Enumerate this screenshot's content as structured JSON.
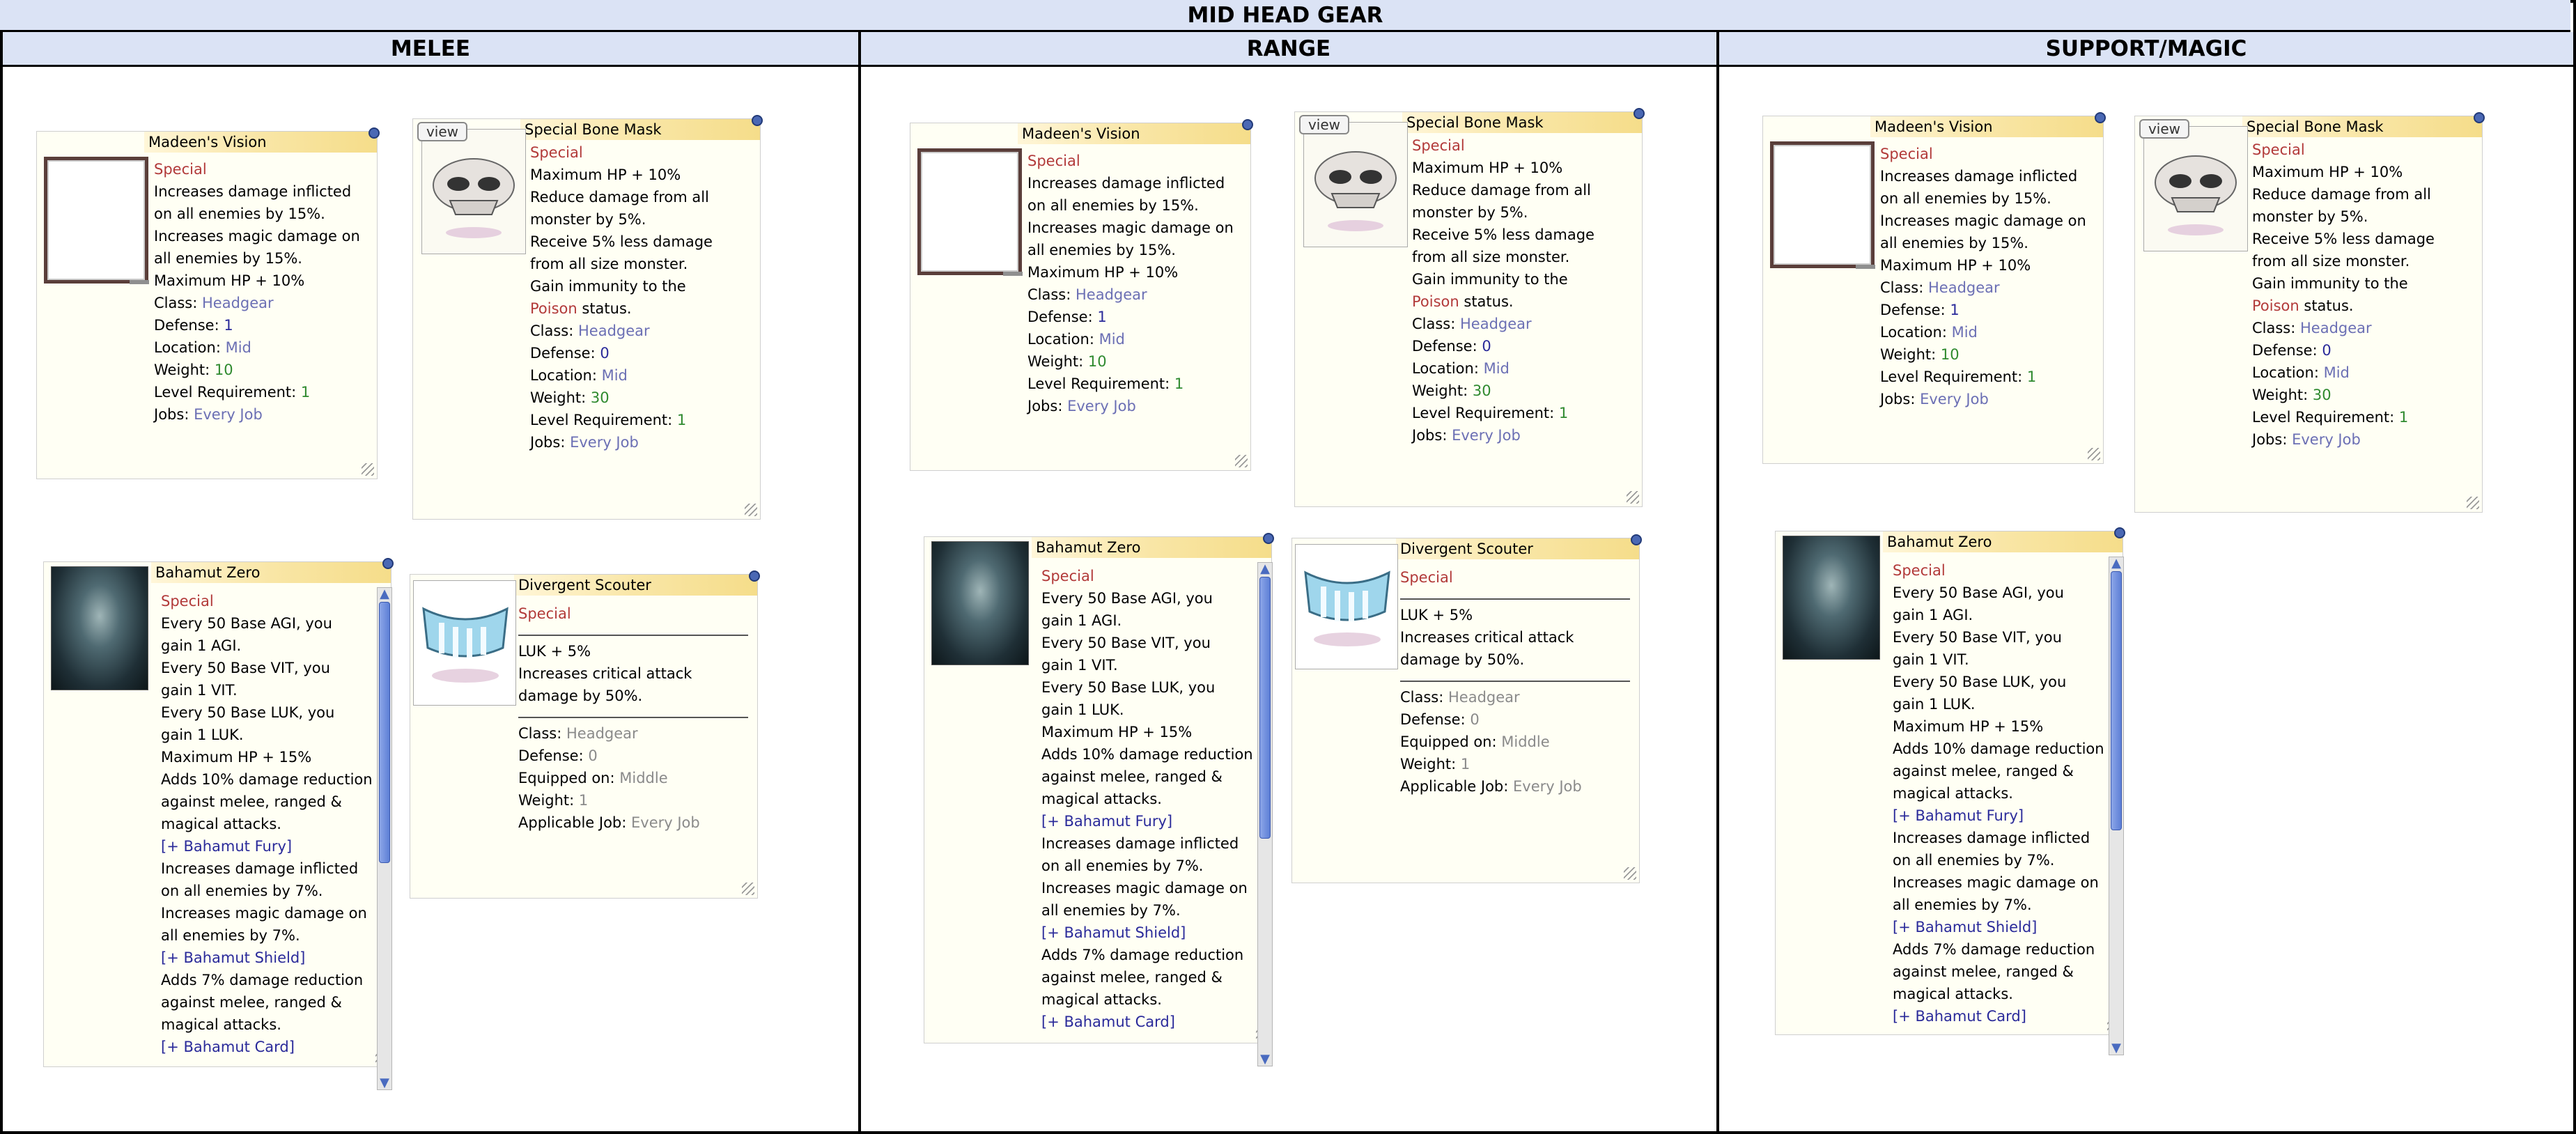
{
  "title": "MID HEAD GEAR",
  "columns": [
    "MELEE",
    "RANGE",
    "SUPPORT/MAGIC"
  ],
  "items": {
    "madeen": {
      "name": "Madeen's Vision",
      "lines": [
        {
          "t": "Special",
          "c": "red"
        },
        {
          "t": "Increases damage inflicted"
        },
        {
          "t": "on all enemies by 15%."
        },
        {
          "t": "Increases magic damage on"
        },
        {
          "t": "all enemies by 15%."
        },
        {
          "t": "Maximum HP + 10%"
        },
        {
          "k": "Class: ",
          "v": "Headgear",
          "c": "blue"
        },
        {
          "k": "Defense: ",
          "v": "1",
          "c": "dblue"
        },
        {
          "k": "Location: ",
          "v": "Mid",
          "c": "blue"
        },
        {
          "k": "Weight: ",
          "v": "10",
          "c": "green"
        },
        {
          "k": "Level Requirement: ",
          "v": "1",
          "c": "green"
        },
        {
          "k": "Jobs: ",
          "v": "Every Job",
          "c": "blue"
        }
      ]
    },
    "bonemask": {
      "name": "Special Bone Mask",
      "view": "view",
      "lines": [
        {
          "t": "Special",
          "c": "red"
        },
        {
          "t": "Maximum HP + 10%"
        },
        {
          "t": "Reduce damage from all"
        },
        {
          "t": "monster by 5%."
        },
        {
          "t": "Receive 5% less damage"
        },
        {
          "t": "from all size monster."
        },
        {
          "t": "Gain immunity to the"
        },
        {
          "k": "Poison",
          "v": " status.",
          "c": "redk"
        },
        {
          "k": "Class: ",
          "v": "Headgear",
          "c": "blue"
        },
        {
          "k": "Defense: ",
          "v": "0",
          "c": "dblue"
        },
        {
          "k": "Location: ",
          "v": "Mid",
          "c": "blue"
        },
        {
          "k": "Weight: ",
          "v": "30",
          "c": "green"
        },
        {
          "k": "Level Requirement: ",
          "v": "1",
          "c": "green"
        },
        {
          "k": "Jobs: ",
          "v": "Every Job",
          "c": "blue"
        }
      ]
    },
    "bahamut": {
      "name": "Bahamut Zero",
      "lines": [
        {
          "t": "Special",
          "c": "red"
        },
        {
          "t": "Every 50 Base AGI, you"
        },
        {
          "t": "gain 1 AGI."
        },
        {
          "t": "Every 50 Base VIT, you"
        },
        {
          "t": "gain 1 VIT."
        },
        {
          "t": "Every 50 Base LUK, you"
        },
        {
          "t": "gain 1 LUK."
        },
        {
          "t": "Maximum HP + 15%"
        },
        {
          "t": "Adds 10% damage reduction"
        },
        {
          "t": "against melee, ranged &"
        },
        {
          "t": "magical attacks."
        },
        {
          "t": "[+ Bahamut Fury]",
          "c": "dblue"
        },
        {
          "t": "Increases damage inflicted"
        },
        {
          "t": "on all enemies by 7%."
        },
        {
          "t": "Increases magic damage on"
        },
        {
          "t": "all enemies by 7%."
        },
        {
          "t": "[+ Bahamut Shield]",
          "c": "dblue"
        },
        {
          "t": "Adds 7% damage reduction"
        },
        {
          "t": "against melee, ranged &"
        },
        {
          "t": "magical attacks."
        },
        {
          "t": "[+ Bahamut Card]",
          "c": "dblue"
        }
      ]
    },
    "scouter": {
      "name": "Divergent Scouter",
      "special": "Special",
      "effect": [
        "LUK + 5%",
        "Increases critical attack",
        "damage by 50%."
      ],
      "stats": [
        {
          "k": "Class: ",
          "v": "Headgear"
        },
        {
          "k": "Defense: ",
          "v": "0"
        },
        {
          "k": "Equipped on:  ",
          "v": "Middle"
        },
        {
          "k": "Weight: ",
          "v": "1"
        },
        {
          "k": "Applicable Job: ",
          "v": "Every Job"
        }
      ]
    }
  },
  "colors": {
    "header_bg": "#dbe3f5",
    "window_bg": "#fffff4",
    "special_red": "#b23a3a",
    "link_blue": "#6b6fb4",
    "green": "#2f8a2f"
  }
}
